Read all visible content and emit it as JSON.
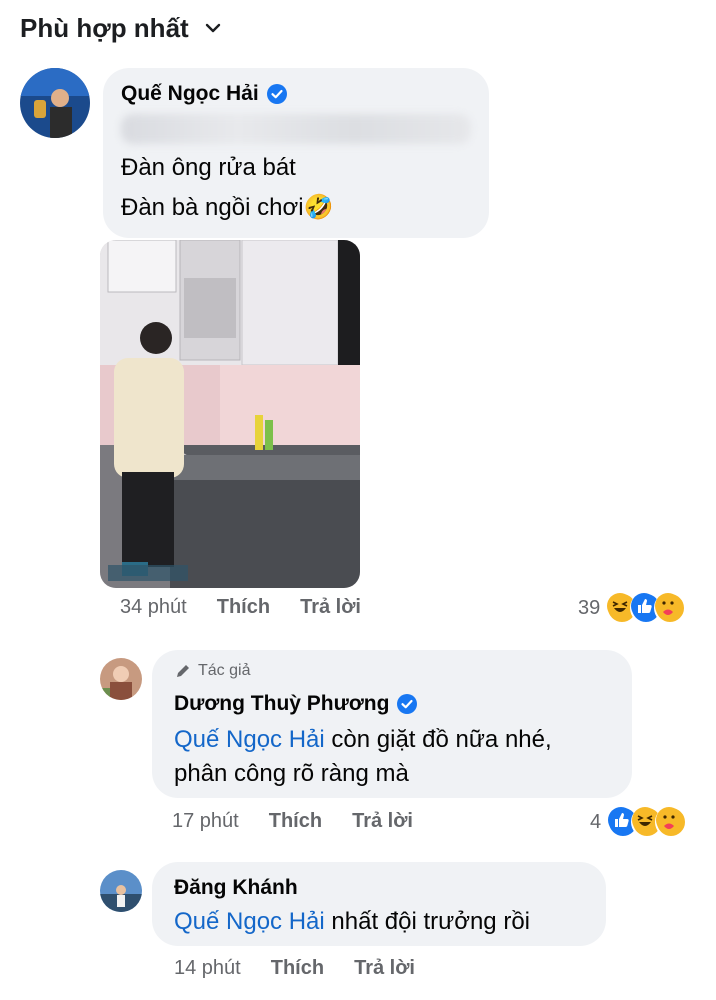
{
  "header": {
    "sort_label": "Phù hợp nhất"
  },
  "comments": [
    {
      "author": "Quế Ngọc Hải",
      "verified": true,
      "lines": [
        "Đàn ông rửa bát",
        "Đàn bà ngồi chơi🤣"
      ],
      "time": "34 phút",
      "like_label": "Thích",
      "reply_label": "Trả lời",
      "reaction_count": "39",
      "reactions": [
        "haha-icon",
        "like-icon",
        "care-icon"
      ]
    },
    {
      "tag": "Tác giả",
      "author": "Dương Thuỳ Phương",
      "verified": true,
      "mention": "Quế Ngọc Hải",
      "text_after_mention": " còn giặt đồ nữa nhé,",
      "line2": "phân công rõ ràng mà",
      "time": "17 phút",
      "like_label": "Thích",
      "reply_label": "Trả lời",
      "reaction_count": "4",
      "reactions": [
        "like-icon",
        "haha-icon",
        "care-icon"
      ]
    },
    {
      "author": "Đăng Khánh",
      "mention": "Quế Ngọc Hải",
      "text_after_mention": " nhất đội trưởng rồi",
      "time": "14 phút",
      "like_label": "Thích",
      "reply_label": "Trả lời"
    }
  ],
  "colors": {
    "mention": "#1467c9",
    "bubble": "#f0f2f5",
    "verified": "#1877f2"
  }
}
